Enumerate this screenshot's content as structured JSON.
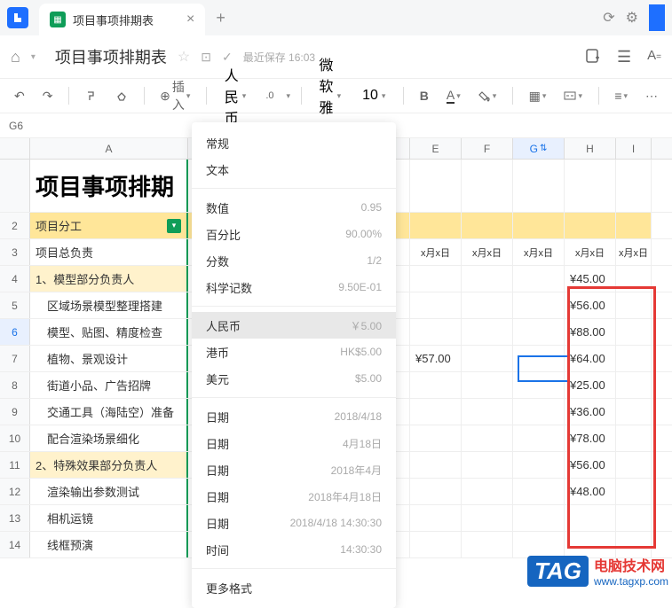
{
  "titlebar": {
    "tab_title": "项目事项排期表"
  },
  "header": {
    "doc_title": "项目事项排期表",
    "save_text": "最近保存 16:03"
  },
  "toolbar": {
    "insert_label": "插入",
    "format_label": "人民币",
    "font_label": "微软雅黑",
    "font_size": "10",
    "bold": "B",
    "text_color": "A"
  },
  "cell_ref": "G6",
  "columns": [
    "A",
    "E",
    "F",
    "G",
    "H",
    "I"
  ],
  "col_widths": {
    "A": 178,
    "E": 58,
    "F": 58,
    "G": 58,
    "H": 58,
    "I": 40
  },
  "hidden_col_width": 250,
  "sheet_title": "项目事项排期",
  "header_row": {
    "a": "项目分工",
    "dates": [
      "x月x日",
      "x月x日",
      "x月x日",
      "x月x日",
      "x月x日"
    ]
  },
  "rows": [
    {
      "n": "3",
      "a": "项目总负责",
      "h": ""
    },
    {
      "n": "4",
      "a": "1、模型部分负责人",
      "h": "¥45.00",
      "yellow": true
    },
    {
      "n": "5",
      "a": "　区域场景模型整理搭建",
      "h": "¥56.00"
    },
    {
      "n": "6",
      "a": "　模型、贴图、精度检查",
      "h": "¥88.00",
      "active": true
    },
    {
      "n": "7",
      "a": "　植物、景观设计",
      "e": "¥57.00",
      "h": "¥64.00"
    },
    {
      "n": "8",
      "a": "　街道小品、广告招牌",
      "h": "¥25.00"
    },
    {
      "n": "9",
      "a": "　交通工具（海陆空）准备",
      "h": "¥36.00"
    },
    {
      "n": "10",
      "a": "　配合渲染场景细化",
      "h": "¥78.00"
    },
    {
      "n": "11",
      "a": "2、特殊效果部分负责人",
      "h": "¥56.00",
      "yellow": true
    },
    {
      "n": "12",
      "a": "　渲染输出参数测试",
      "h": "¥48.00"
    },
    {
      "n": "13",
      "a": "　相机运镜",
      "h": ""
    },
    {
      "n": "14",
      "a": "　线框预演",
      "h": ""
    }
  ],
  "format_menu": [
    {
      "label": "常规",
      "sample": ""
    },
    {
      "label": "文本",
      "sample": ""
    },
    {
      "sep": true
    },
    {
      "label": "数值",
      "sample": "0.95"
    },
    {
      "label": "百分比",
      "sample": "90.00%"
    },
    {
      "label": "分数",
      "sample": "1/2"
    },
    {
      "label": "科学记数",
      "sample": "9.50E-01"
    },
    {
      "sep": true
    },
    {
      "label": "人民币",
      "sample": "￥5.00",
      "selected": true
    },
    {
      "label": "港币",
      "sample": "HK$5.00"
    },
    {
      "label": "美元",
      "sample": "$5.00"
    },
    {
      "sep": true
    },
    {
      "label": "日期",
      "sample": "2018/4/18"
    },
    {
      "label": "日期",
      "sample": "4月18日"
    },
    {
      "label": "日期",
      "sample": "2018年4月"
    },
    {
      "label": "日期",
      "sample": "2018年4月18日"
    },
    {
      "label": "日期",
      "sample": "2018/4/18 14:30:30"
    },
    {
      "label": "时间",
      "sample": "14:30:30"
    },
    {
      "sep": true
    },
    {
      "label": "更多格式",
      "sample": ""
    }
  ],
  "watermark": {
    "tag": "TAG",
    "line1": "电脑技术网",
    "line2": "www.tagxp.com"
  }
}
